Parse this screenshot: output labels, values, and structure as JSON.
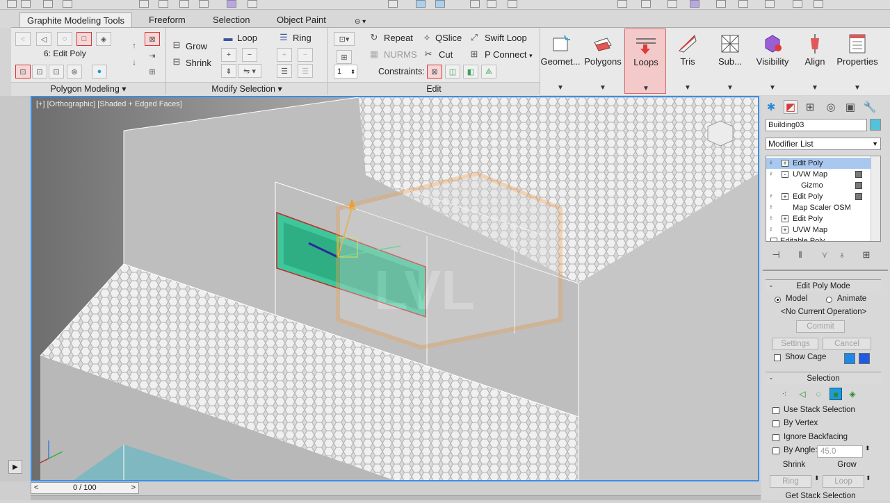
{
  "ribbon": {
    "tabs": [
      "Graphite Modeling Tools",
      "Freeform",
      "Selection",
      "Object Paint"
    ],
    "active_tab": "Graphite Modeling Tools",
    "polygon_modeling": {
      "level_text": "6: Edit Poly",
      "panel_label": "Polygon Modeling"
    },
    "modify_selection": {
      "grow": "Grow",
      "shrink": "Shrink",
      "loop": "Loop",
      "ring": "Ring",
      "panel_label": "Modify Selection"
    },
    "edit": {
      "repeat": "Repeat",
      "qslice": "QSlice",
      "swift_loop": "Swift Loop",
      "nurms": "NURMS",
      "cut": "Cut",
      "p_connect": "P Connect",
      "constraints": "Constraints:",
      "spinner_value": "1",
      "panel_label": "Edit"
    },
    "big_buttons": [
      "Geomet...",
      "Polygons",
      "Loops",
      "Tris",
      "Sub...",
      "Visibility",
      "Align",
      "Properties"
    ],
    "active_big_button": "Loops"
  },
  "viewport": {
    "label": "[+] [Orthographic] [Shaded + Edged Faces]",
    "accent_color": "#3b8ee6",
    "selection_color": "#3ec79a"
  },
  "timeline": {
    "frame": "0 / 100"
  },
  "command_panel": {
    "object_name": "Building03",
    "object_color": "#54c2d8",
    "modifier_list": "Modifier List",
    "stack": [
      {
        "label": "Edit Poly",
        "expander": "+",
        "selected": true
      },
      {
        "label": "UVW Map",
        "expander": "-",
        "selected": false
      },
      {
        "label": "Gizmo",
        "expander": "",
        "selected": false
      },
      {
        "label": "Edit Poly",
        "expander": "+",
        "selected": false
      },
      {
        "label": "Map Scaler OSM",
        "expander": "",
        "selected": false
      },
      {
        "label": "Edit Poly",
        "expander": "+",
        "selected": false
      },
      {
        "label": "UVW Map",
        "expander": "+",
        "selected": false
      },
      {
        "label": "Editable Poly",
        "expander": "",
        "selected": false
      }
    ],
    "edit_poly_mode": {
      "title": "Edit Poly Mode",
      "model": "Model",
      "animate": "Animate",
      "current_operation": "<No Current Operation>",
      "commit": "Commit",
      "settings": "Settings",
      "cancel": "Cancel",
      "show_cage": "Show Cage"
    },
    "selection": {
      "title": "Selection",
      "use_stack_selection": "Use Stack Selection",
      "by_vertex": "By Vertex",
      "ignore_backfacing": "Ignore Backfacing",
      "by_angle": "By Angle:",
      "angle_value": "45.0",
      "shrink": "Shrink",
      "grow": "Grow",
      "ring": "Ring",
      "loop": "Loop",
      "get_stack_selection": "Get Stack Selection"
    }
  }
}
